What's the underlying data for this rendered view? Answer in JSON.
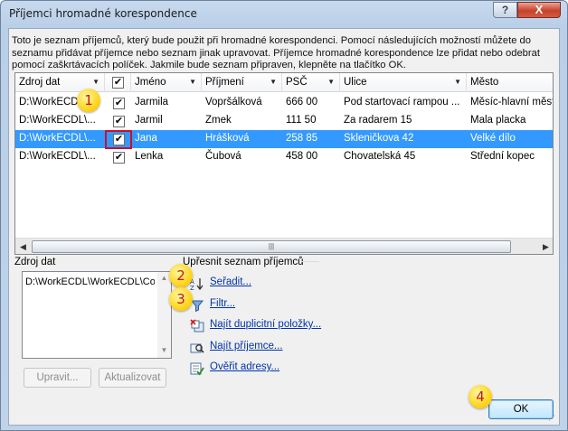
{
  "window": {
    "title": "Příjemci hromadné korespondence",
    "help_label": "?",
    "close_label": "X"
  },
  "intro_text": "Toto je seznam příjemců, který bude použit při hromadné korespondenci. Pomocí následujících možností můžete do seznamu přidávat příjemce nebo seznam jinak upravovat. Příjemce hromadné korespondence lze přidat nebo odebrat pomocí zaškrtávacích políček. Jakmile bude seznam připraven, klepněte na tlačítko OK.",
  "table": {
    "columns": [
      "Zdroj dat",
      "",
      "Jméno",
      "Příjmení",
      "PSČ",
      "Ulice",
      "Město"
    ],
    "rows": [
      {
        "source": "D:\\WorkECDL\\...",
        "checked": true,
        "jmeno": "Jarmila",
        "prijmeni": "Vopršálková",
        "psc": "666 00",
        "ulice": "Pod startovací rampou ...",
        "mesto": "Měsíc-hlavní měst"
      },
      {
        "source": "D:\\WorkECDL\\...",
        "checked": true,
        "jmeno": "Jarmil",
        "prijmeni": "Zmek",
        "psc": "111 50",
        "ulice": "Za radarem 15",
        "mesto": "Mala placka"
      },
      {
        "source": "D:\\WorkECDL\\...",
        "checked": true,
        "jmeno": "Jana",
        "prijmeni": "Hrášková",
        "psc": "258 85",
        "ulice": "Skleničkova 42",
        "mesto": "Velké dílo"
      },
      {
        "source": "D:\\WorkECDL\\...",
        "checked": true,
        "jmeno": "Lenka",
        "prijmeni": "Čubová",
        "psc": "458 00",
        "ulice": "Chovatelská 45",
        "mesto": "Střední kopec"
      }
    ],
    "check_mark": "✔",
    "selected_row": 2
  },
  "datasource": {
    "label": "Zdroj dat",
    "item": "D:\\WorkECDL\\WorkECDL\\Cons",
    "edit_label": "Upravit...",
    "refresh_label": "Aktualizovat"
  },
  "refine": {
    "label": "Upřesnit seznam příjemců",
    "sort": "Seřadit...",
    "filter": "Filtr...",
    "duplicates": "Najít duplicitní položky...",
    "find": "Najít příjemce...",
    "validate": "Ověřit adresy..."
  },
  "ok_label": "OK",
  "badges": [
    "1",
    "2",
    "3",
    "4"
  ],
  "colors": {
    "selection": "#3399ff",
    "link": "#0033aa",
    "highlight_outline": "#c8102e",
    "badge": "#ffd51c",
    "badge_text": "#c2191f"
  }
}
